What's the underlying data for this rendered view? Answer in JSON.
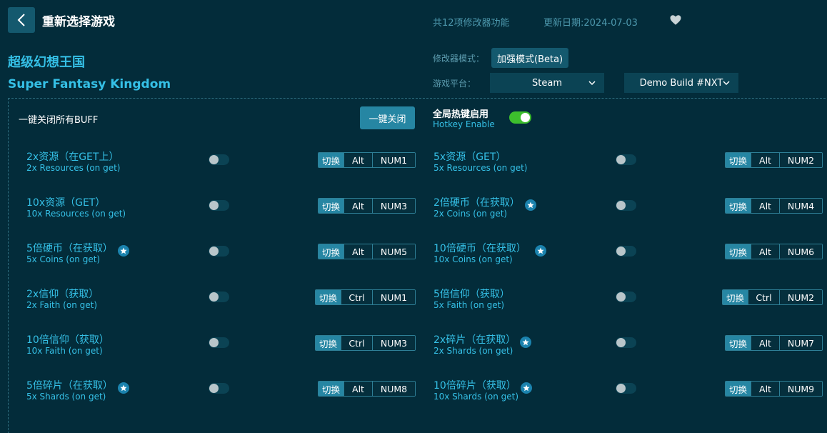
{
  "header": {
    "title": "重新选择游戏",
    "feature_count": "共12项修改器功能",
    "update_date": "更新日期:2024-07-03"
  },
  "game": {
    "name_cn": "超级幻想王国",
    "name_en": "Super Fantasy Kingdom"
  },
  "meta": {
    "mode_label": "修改器模式：",
    "mode_value": "加强模式(Beta)",
    "platform_label": "游戏平台：",
    "platform_value": "Steam",
    "version_value": "Demo Build #NXT"
  },
  "controls": {
    "all_off_label": "一键关闭所有BUFF",
    "all_off_button": "一键关闭",
    "hotkey_cn": "全局热键启用",
    "hotkey_en": "Hotkey Enable"
  },
  "features": [
    {
      "cn": "2x资源（在GET上）",
      "en": "2x Resources (on get)",
      "star": false,
      "switch": "切换",
      "mod": "Alt",
      "key": "NUM1"
    },
    {
      "cn": "5x资源（GET）",
      "en": "5x Resources (on get)",
      "star": false,
      "switch": "切换",
      "mod": "Alt",
      "key": "NUM2"
    },
    {
      "cn": "10x资源（GET）",
      "en": "10x Resources (on get)",
      "star": false,
      "switch": "切换",
      "mod": "Alt",
      "key": "NUM3"
    },
    {
      "cn": "2倍硬币（在获取）",
      "en": "2x Coins (on get)",
      "star": true,
      "switch": "切换",
      "mod": "Alt",
      "key": "NUM4"
    },
    {
      "cn": "5倍硬币（在获取）",
      "en": "5x Coins (on get)",
      "star": true,
      "switch": "切换",
      "mod": "Alt",
      "key": "NUM5"
    },
    {
      "cn": "10倍硬币（在获取）",
      "en": "10x Coins (on get)",
      "star": true,
      "switch": "切换",
      "mod": "Alt",
      "key": "NUM6"
    },
    {
      "cn": "2x信仰（获取）",
      "en": "2x Faith (on get)",
      "star": false,
      "switch": "切换",
      "mod": "Ctrl",
      "key": "NUM1"
    },
    {
      "cn": "5倍信仰（获取）",
      "en": "5x Faith (on get)",
      "star": false,
      "switch": "切换",
      "mod": "Ctrl",
      "key": "NUM2"
    },
    {
      "cn": "10倍信仰（获取）",
      "en": "10x Faith (on get)",
      "star": false,
      "switch": "切换",
      "mod": "Ctrl",
      "key": "NUM3"
    },
    {
      "cn": "2x碎片（在获取）",
      "en": "2x Shards (on get)",
      "star": true,
      "switch": "切换",
      "mod": "Alt",
      "key": "NUM7"
    },
    {
      "cn": "5倍碎片（在获取）",
      "en": "5x Shards (on get)",
      "star": true,
      "switch": "切换",
      "mod": "Alt",
      "key": "NUM8"
    },
    {
      "cn": "10倍碎片（获取）",
      "en": "10x Shards (on get)",
      "star": true,
      "switch": "切换",
      "mod": "Alt",
      "key": "NUM9"
    }
  ]
}
